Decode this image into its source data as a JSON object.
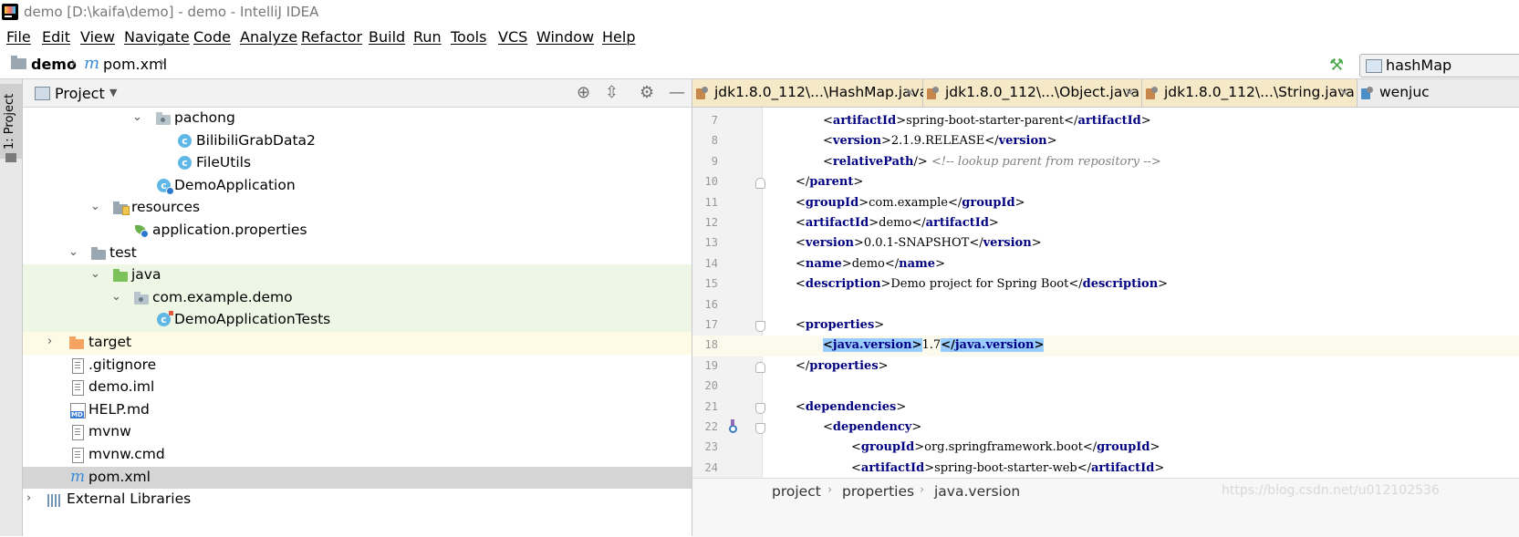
{
  "window": {
    "title": "demo [D:\\kaifa\\demo] - demo - IntelliJ IDEA"
  },
  "menu": [
    "File",
    "Edit",
    "View",
    "Navigate",
    "Code",
    "Analyze",
    "Refactor",
    "Build",
    "Run",
    "Tools",
    "VCS",
    "Window",
    "Help"
  ],
  "navbar": {
    "project": "demo",
    "file": "pom.xml",
    "run_config": "hashMap"
  },
  "side_strip": {
    "project_tab": "1: Project"
  },
  "project_panel": {
    "title": "Project",
    "tree": [
      {
        "label": "pachong",
        "icon": "package-icon"
      },
      {
        "label": "BilibiliGrabData2",
        "icon": "class-icon"
      },
      {
        "label": "FileUtils",
        "icon": "class-icon"
      },
      {
        "label": "DemoApplication",
        "icon": "spring-boot-class-icon"
      },
      {
        "label": "resources",
        "icon": "resources-folder-icon"
      },
      {
        "label": "application.properties",
        "icon": "spring-properties-icon"
      },
      {
        "label": "test",
        "icon": "folder-icon"
      },
      {
        "label": "java",
        "icon": "test-sources-folder-icon"
      },
      {
        "label": "com.example.demo",
        "icon": "package-icon"
      },
      {
        "label": "DemoApplicationTests",
        "icon": "test-class-icon"
      },
      {
        "label": "target",
        "icon": "excluded-folder-icon"
      },
      {
        "label": ".gitignore",
        "icon": "text-file-icon"
      },
      {
        "label": "demo.iml",
        "icon": "text-file-icon"
      },
      {
        "label": "HELP.md",
        "icon": "markdown-file-icon"
      },
      {
        "label": "mvnw",
        "icon": "text-file-icon"
      },
      {
        "label": "mvnw.cmd",
        "icon": "text-file-icon"
      },
      {
        "label": "pom.xml",
        "icon": "maven-file-icon"
      },
      {
        "label": "External Libraries",
        "icon": "libraries-icon"
      }
    ]
  },
  "editor": {
    "tabs": [
      {
        "label": "jdk1.8.0_112\\...\\HashMap.java"
      },
      {
        "label": "jdk1.8.0_112\\...\\Object.java"
      },
      {
        "label": "jdk1.8.0_112\\...\\String.java"
      },
      {
        "label": "wenjuc"
      }
    ],
    "lines": [
      {
        "n": "7",
        "tag": "artifactId",
        "text": "spring-boot-starter-parent"
      },
      {
        "n": "8",
        "tag": "version",
        "text": "2.1.9.RELEASE"
      },
      {
        "n": "9",
        "tag": "relativePath",
        "comment": "<!-- lookup parent from repository -->"
      },
      {
        "n": "10",
        "tag": "parent"
      },
      {
        "n": "11",
        "tag": "groupId",
        "text": "com.example"
      },
      {
        "n": "12",
        "tag": "artifactId",
        "text": "demo"
      },
      {
        "n": "13",
        "tag": "version",
        "text": "0.0.1-SNAPSHOT"
      },
      {
        "n": "14",
        "tag": "name",
        "text": "demo"
      },
      {
        "n": "15",
        "tag": "description",
        "text": "Demo project for Spring Boot"
      },
      {
        "n": "16"
      },
      {
        "n": "17",
        "tag": "properties"
      },
      {
        "n": "18",
        "tag": "java.version",
        "text": "1.7"
      },
      {
        "n": "19",
        "tag": "properties"
      },
      {
        "n": "20"
      },
      {
        "n": "21",
        "tag": "dependencies"
      },
      {
        "n": "22",
        "tag": "dependency"
      },
      {
        "n": "23",
        "tag": "groupId",
        "text": "org.springframework.boot"
      },
      {
        "n": "24",
        "tag": "artifactId",
        "text": "spring-boot-starter-web"
      }
    ],
    "breadcrumbs": [
      "project",
      "properties",
      "java.version"
    ],
    "watermark": "https://blog.csdn.net/u012102536"
  }
}
